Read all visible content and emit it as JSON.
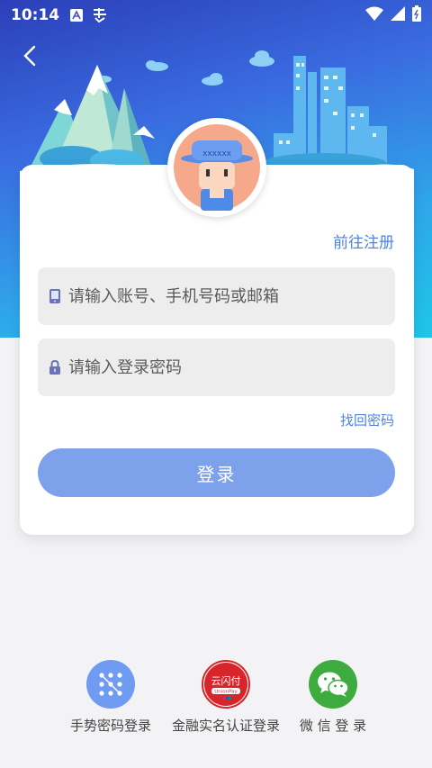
{
  "status_bar": {
    "time": "10:14"
  },
  "register_link": "前往注册",
  "account_field": {
    "placeholder": "请输入账号、手机号码或邮箱"
  },
  "password_field": {
    "placeholder": "请输入登录密码"
  },
  "forgot_link": "找回密码",
  "login_button": "登录",
  "alt_logins": {
    "gesture_label": "手势密码登录",
    "financial_label": "金融实名认证登录",
    "wechat_label": "微 信 登 录",
    "unionpay_brand": "云闪付",
    "unionpay_sub": "UnionPay"
  },
  "colors": {
    "accent": "#4d82e6",
    "button": "#7ea1ec",
    "gesture": "#6f9cf2",
    "unionpay": "#d8242b",
    "wechat": "#3dab3d"
  },
  "icons": {
    "back": "chevron-left-icon",
    "account": "phone-icon",
    "password": "lock-icon",
    "gesture": "gesture-dots-icon",
    "financial": "unionpay-icon",
    "wechat": "wechat-icon"
  }
}
